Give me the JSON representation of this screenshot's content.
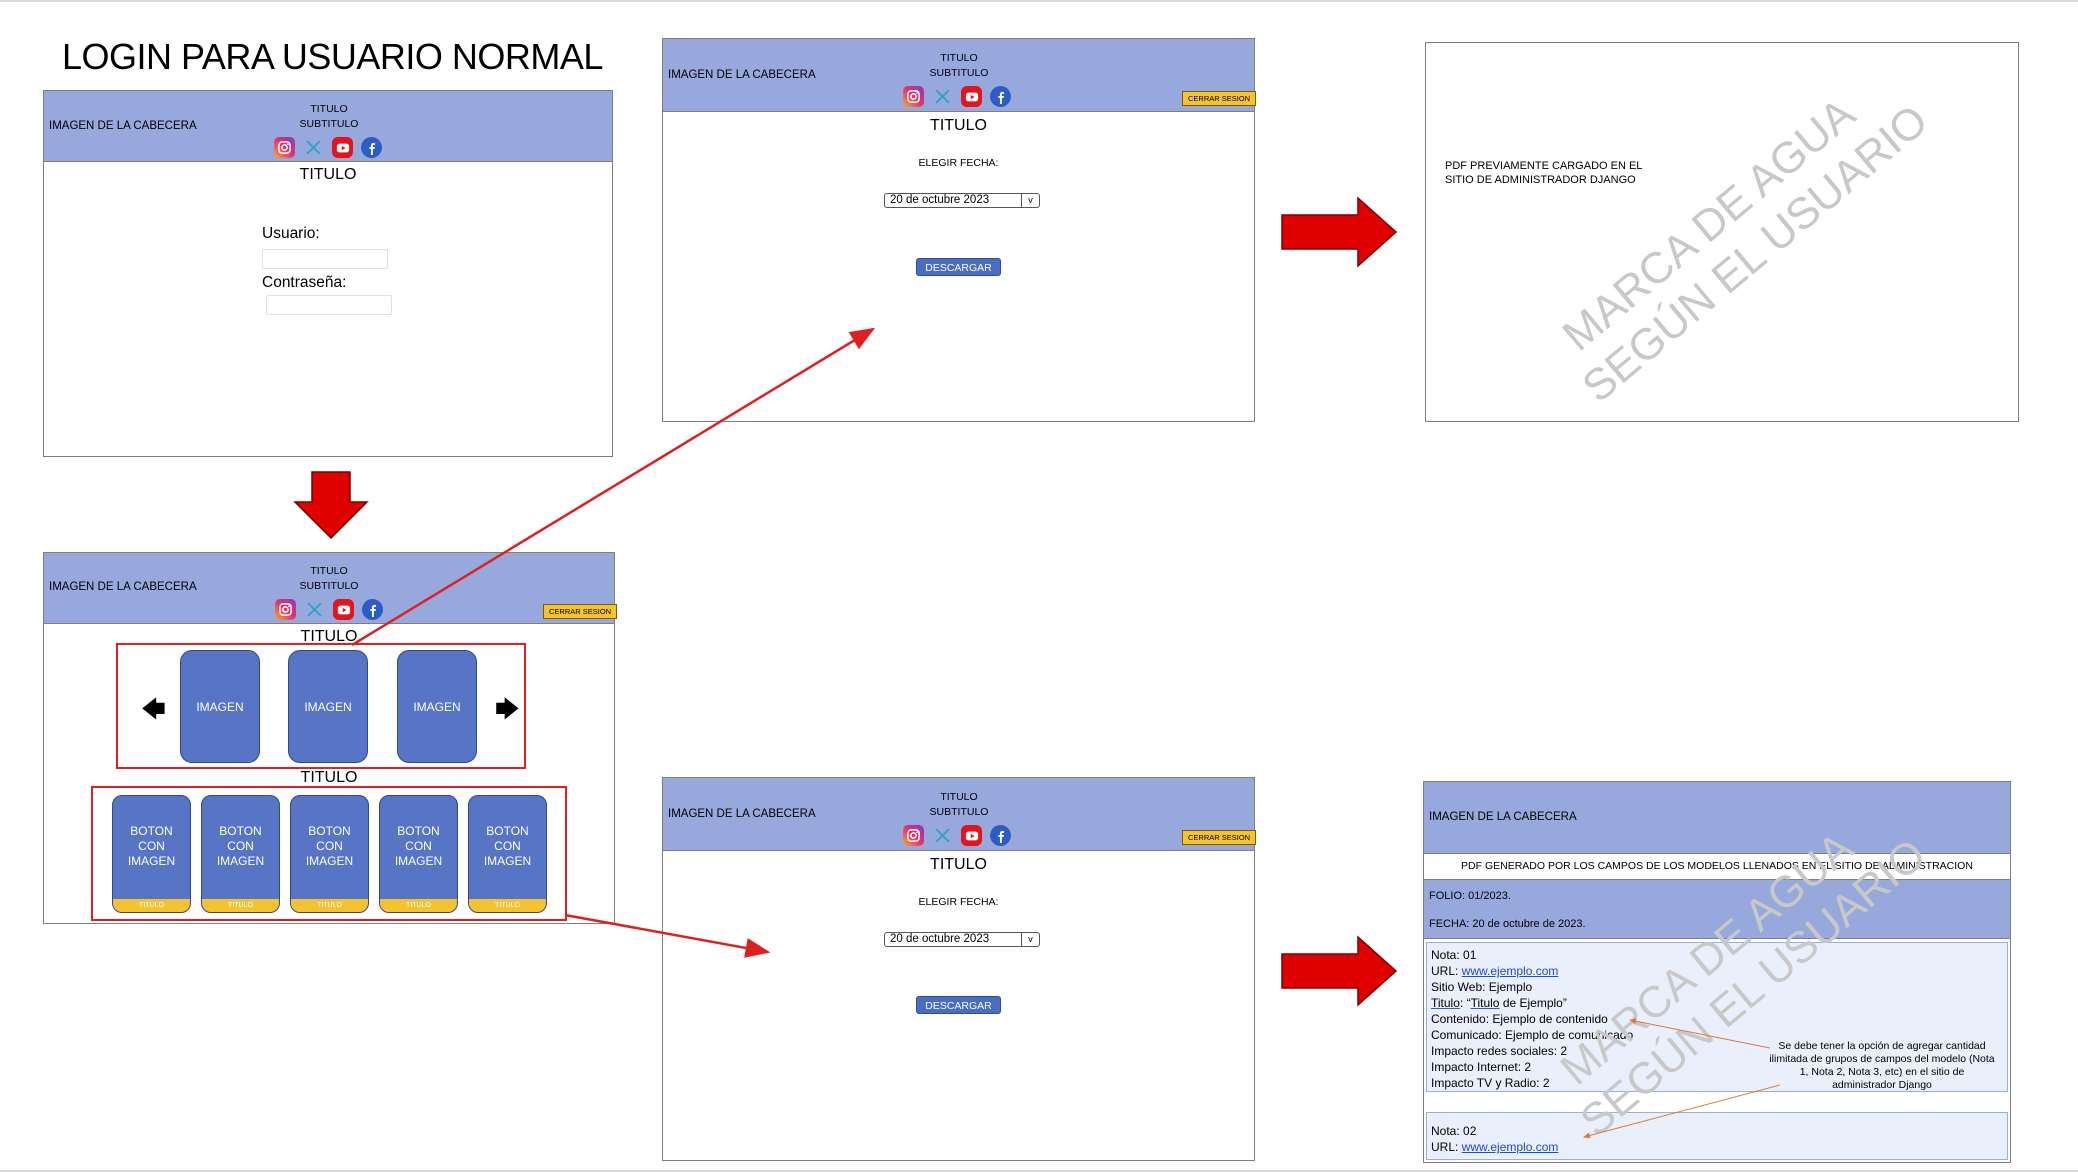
{
  "page_title": "LOGIN PARA USUARIO NORMAL",
  "header": {
    "image_label": "IMAGEN DE LA CABECERA",
    "title": "TITULO",
    "subtitle": "SUBTITULO",
    "logout_label": "CERRAR SESION"
  },
  "socials": [
    "instagram-icon",
    "x-icon",
    "youtube-icon",
    "facebook-icon"
  ],
  "colors": {
    "header_bg": "#96a8dc",
    "card": "#5874c4",
    "strip": "#f5c230",
    "arrow": "#e00000",
    "link": "#1a4bd1"
  },
  "login": {
    "main_title": "TITULO",
    "user_label": "Usuario:",
    "password_label": "Contraseña:"
  },
  "home": {
    "carousel_title": "TITULO",
    "carousel_items": [
      "IMAGEN",
      "IMAGEN",
      "IMAGEN"
    ],
    "buttons_title": "TITULO",
    "buttons": [
      {
        "label": "BOTON CON IMAGEN",
        "caption": "TITULO"
      },
      {
        "label": "BOTON CON IMAGEN",
        "caption": "TITULO"
      },
      {
        "label": "BOTON CON IMAGEN",
        "caption": "TITULO"
      },
      {
        "label": "BOTON CON IMAGEN",
        "caption": "TITULO"
      },
      {
        "label": "BOTON CON IMAGEN",
        "caption": "TITULO"
      }
    ]
  },
  "download": {
    "main_title": "TITULO",
    "date_label": "ELEGIR FECHA:",
    "date_value": "20 de octubre 2023",
    "download_label": "DESCARGAR"
  },
  "pdf_loaded": {
    "text_line1": "PDF PREVIAMENTE CARGADO EN EL",
    "text_line2": "SITIO DE ADMINISTRADOR DJANGO",
    "watermark_line1": "MARCA DE AGUA",
    "watermark_line2": "SEGÚN EL USUARIO"
  },
  "pdf_generated": {
    "header_image": "IMAGEN DE LA CABECERA",
    "heading": "PDF GENERADO POR LOS CAMPOS DE LOS MODELOS LLENADOS EN EL SITIO DE ADMINISTRACION",
    "folio": "FOLIO: 01/2023.",
    "fecha": "FECHA: 20 de octubre de 2023.",
    "note1": {
      "nota": "Nota: 01",
      "url_label": "URL: ",
      "url": "www.ejemplo.com",
      "sitio": "Sitio Web: Ejemplo",
      "titulo_label": "Titulo",
      "titulo_rest": ": “",
      "titulo_word": "Titulo",
      "titulo_end": " de Ejemplo”",
      "contenido": "Contenido: Ejemplo de contenido",
      "comunicado": "Comunicado: Ejemplo de comunicado",
      "redes": "Impacto redes sociales: 2",
      "internet": "Impacto Internet: 2",
      "tv": "Impacto TV y Radio: 2"
    },
    "note2": {
      "nota": "Nota: 02",
      "url_label": "URL: ",
      "url": "www.ejemplo.com"
    },
    "annotation": "Se debe tener la opción de agregar cantidad ilimitada de grupos de campos del modelo (Nota 1, Nota 2, Nota 3, etc) en el sitio de administrador Django",
    "watermark_line1": "MARCA DE AGUA",
    "watermark_line2": "SEGÚN EL USUARIO"
  }
}
